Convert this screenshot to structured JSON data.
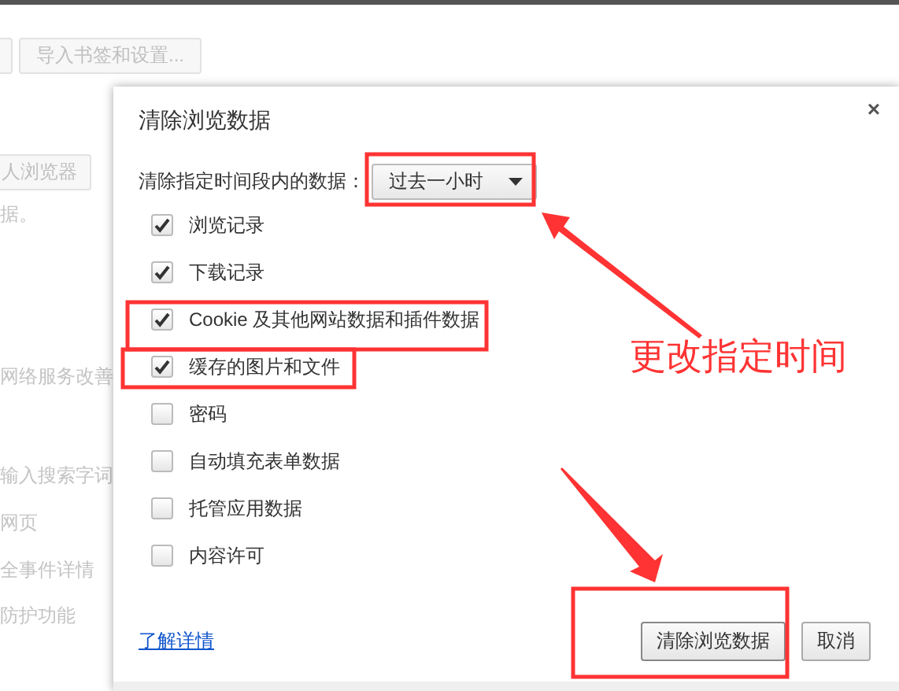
{
  "background_page": {
    "import_button": "导入书签和设置...",
    "browser_button": "人浏览器",
    "texts": [
      "据。",
      "网络服务改善",
      "输入搜索字词",
      "网页",
      "全事件详情",
      "防护功能"
    ]
  },
  "dialog": {
    "title": "清除浏览数据",
    "close": "×",
    "range_label": "清除指定时间段内的数据：",
    "range_value": "过去一小时",
    "checkboxes": [
      {
        "label": "浏览记录",
        "checked": true
      },
      {
        "label": "下载记录",
        "checked": true
      },
      {
        "label": "Cookie 及其他网站数据和插件数据",
        "checked": true
      },
      {
        "label": "缓存的图片和文件",
        "checked": true
      },
      {
        "label": "密码",
        "checked": false
      },
      {
        "label": "自动填充表单数据",
        "checked": false
      },
      {
        "label": "托管应用数据",
        "checked": false
      },
      {
        "label": "内容许可",
        "checked": false
      }
    ],
    "link": "了解详情",
    "buttons": [
      {
        "label": "清除浏览数据",
        "kind": "confirm"
      },
      {
        "label": "取消",
        "kind": "cancel"
      }
    ]
  },
  "annotation": {
    "label": "更改指定时间"
  }
}
